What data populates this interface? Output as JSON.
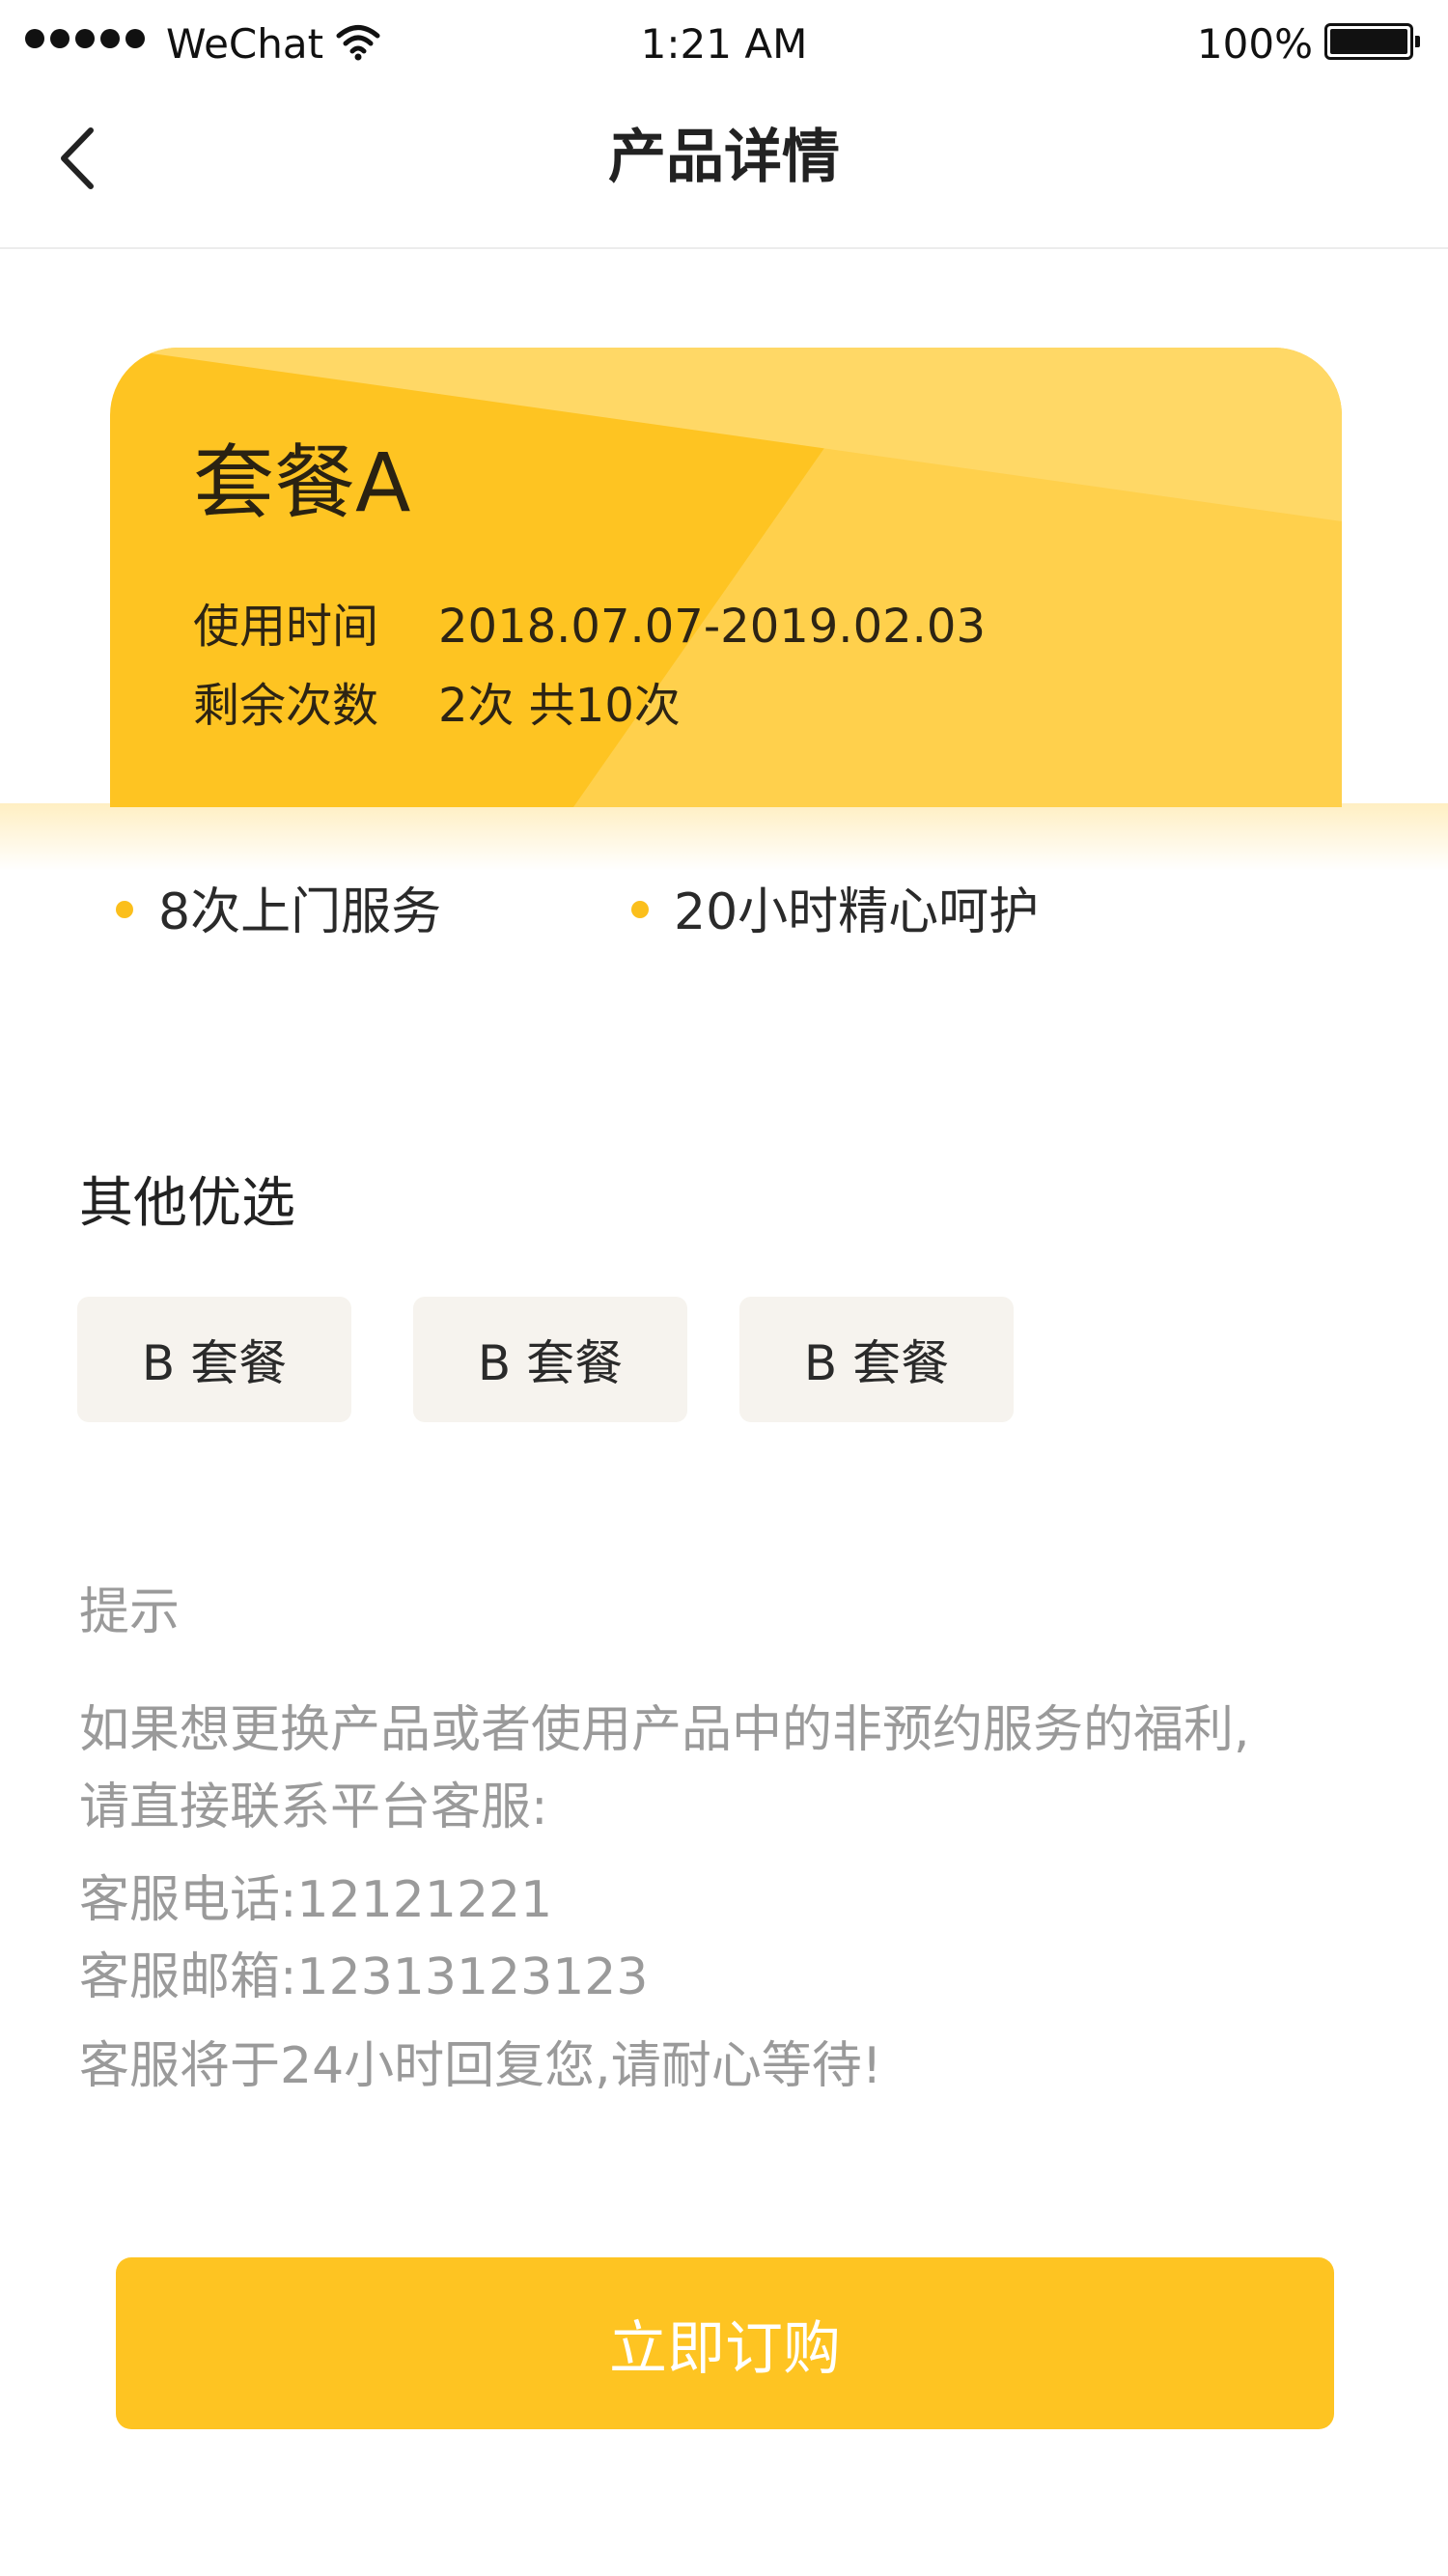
{
  "status_bar": {
    "carrier": "WeChat",
    "time": "1:21 AM",
    "battery": "100%",
    "icons": [
      "signal-dots-icon",
      "wifi-icon",
      "battery-icon"
    ]
  },
  "nav": {
    "title": "产品详情",
    "back_icon": "chevron-left-icon"
  },
  "product": {
    "name": "套餐A",
    "usage_label": "使用时间",
    "usage_value": "2018.07.07-2019.02.03",
    "remaining_label": "剩余次数",
    "remaining_value": "2次 共10次"
  },
  "features": [
    "8次上门服务",
    "20小时精心呵护"
  ],
  "other_options": {
    "title": "其他优选",
    "items": [
      "B 套餐",
      "B 套餐",
      "B 套餐"
    ]
  },
  "tips": {
    "title": "提示",
    "line1": "如果想更换产品或者使用产品中的非预约服务的福利,",
    "line2": "请直接联系平台客服:",
    "phone": "客服电话:12121221",
    "email": "客服邮箱:12313123123",
    "reply": "客服将于24小时回复您,请耐心等待!"
  },
  "order_button": {
    "label": "立即订购"
  },
  "colors": {
    "accent": "#fec422",
    "option_bg": "#f6f3ee",
    "tip_text": "#9a9a9a"
  }
}
